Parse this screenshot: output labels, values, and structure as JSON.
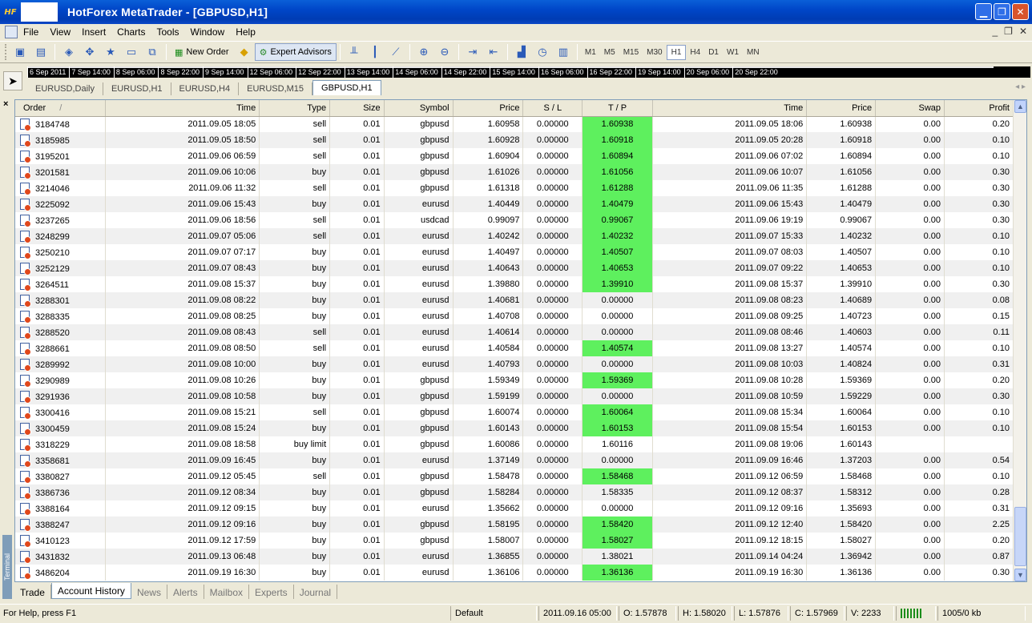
{
  "window": {
    "title": "HotForex MetaTrader - [GBPUSD,H1]",
    "app_logo": "HF"
  },
  "menu": [
    "File",
    "View",
    "Insert",
    "Charts",
    "Tools",
    "Window",
    "Help"
  ],
  "toolbar": {
    "new_order_label": "New Order",
    "expert_advisors_label": "Expert Advisors",
    "timeframes": [
      "M1",
      "M5",
      "M15",
      "M30",
      "H1",
      "H4",
      "D1",
      "W1",
      "MN"
    ],
    "selected_timeframe": "H1"
  },
  "timeline": [
    "6 Sep 2011",
    "7 Sep 14:00",
    "8 Sep 06:00",
    "8 Sep 22:00",
    "9 Sep 14:00",
    "12 Sep 06:00",
    "12 Sep 22:00",
    "13 Sep 14:00",
    "14 Sep 06:00",
    "14 Sep 22:00",
    "15 Sep 14:00",
    "16 Sep 06:00",
    "16 Sep 22:00",
    "19 Sep 14:00",
    "20 Sep 06:00",
    "20 Sep 22:00"
  ],
  "chart_tabs": [
    "EURUSD,Daily",
    "EURUSD,H1",
    "EURUSD,H4",
    "EURUSD,M15",
    "GBPUSD,H1"
  ],
  "active_chart_tab": "GBPUSD,H1",
  "terminal_label": "Terminal",
  "columns": {
    "order": "Order",
    "sort_mark": "/",
    "time": "Time",
    "type": "Type",
    "size": "Size",
    "symbol": "Symbol",
    "price": "Price",
    "sl": "S / L",
    "tp": "T / P",
    "close_time": "Time",
    "close_price": "Price",
    "swap": "Swap",
    "profit": "Profit"
  },
  "highlight_color": "#5ef05e",
  "rows": [
    {
      "order": "3184748",
      "time": "2011.09.05 18:05",
      "type": "sell",
      "size": "0.01",
      "symbol": "gbpusd",
      "price": "1.60958",
      "sl": "0.00000",
      "tp": "1.60938",
      "tp_hit": true,
      "close_time": "2011.09.05 18:06",
      "close_price": "1.60938",
      "swap": "0.00",
      "profit": "0.20"
    },
    {
      "order": "3185985",
      "time": "2011.09.05 18:50",
      "type": "sell",
      "size": "0.01",
      "symbol": "gbpusd",
      "price": "1.60928",
      "sl": "0.00000",
      "tp": "1.60918",
      "tp_hit": true,
      "close_time": "2011.09.05 20:28",
      "close_price": "1.60918",
      "swap": "0.00",
      "profit": "0.10"
    },
    {
      "order": "3195201",
      "time": "2011.09.06 06:59",
      "type": "sell",
      "size": "0.01",
      "symbol": "gbpusd",
      "price": "1.60904",
      "sl": "0.00000",
      "tp": "1.60894",
      "tp_hit": true,
      "close_time": "2011.09.06 07:02",
      "close_price": "1.60894",
      "swap": "0.00",
      "profit": "0.10"
    },
    {
      "order": "3201581",
      "time": "2011.09.06 10:06",
      "type": "buy",
      "size": "0.01",
      "symbol": "gbpusd",
      "price": "1.61026",
      "sl": "0.00000",
      "tp": "1.61056",
      "tp_hit": true,
      "close_time": "2011.09.06 10:07",
      "close_price": "1.61056",
      "swap": "0.00",
      "profit": "0.30"
    },
    {
      "order": "3214046",
      "time": "2011.09.06 11:32",
      "type": "sell",
      "size": "0.01",
      "symbol": "gbpusd",
      "price": "1.61318",
      "sl": "0.00000",
      "tp": "1.61288",
      "tp_hit": true,
      "close_time": "2011.09.06 11:35",
      "close_price": "1.61288",
      "swap": "0.00",
      "profit": "0.30"
    },
    {
      "order": "3225092",
      "time": "2011.09.06 15:43",
      "type": "buy",
      "size": "0.01",
      "symbol": "eurusd",
      "price": "1.40449",
      "sl": "0.00000",
      "tp": "1.40479",
      "tp_hit": true,
      "close_time": "2011.09.06 15:43",
      "close_price": "1.40479",
      "swap": "0.00",
      "profit": "0.30"
    },
    {
      "order": "3237265",
      "time": "2011.09.06 18:56",
      "type": "sell",
      "size": "0.01",
      "symbol": "usdcad",
      "price": "0.99097",
      "sl": "0.00000",
      "tp": "0.99067",
      "tp_hit": true,
      "close_time": "2011.09.06 19:19",
      "close_price": "0.99067",
      "swap": "0.00",
      "profit": "0.30"
    },
    {
      "order": "3248299",
      "time": "2011.09.07 05:06",
      "type": "sell",
      "size": "0.01",
      "symbol": "eurusd",
      "price": "1.40242",
      "sl": "0.00000",
      "tp": "1.40232",
      "tp_hit": true,
      "close_time": "2011.09.07 15:33",
      "close_price": "1.40232",
      "swap": "0.00",
      "profit": "0.10"
    },
    {
      "order": "3250210",
      "time": "2011.09.07 07:17",
      "type": "buy",
      "size": "0.01",
      "symbol": "eurusd",
      "price": "1.40497",
      "sl": "0.00000",
      "tp": "1.40507",
      "tp_hit": true,
      "close_time": "2011.09.07 08:03",
      "close_price": "1.40507",
      "swap": "0.00",
      "profit": "0.10"
    },
    {
      "order": "3252129",
      "time": "2011.09.07 08:43",
      "type": "buy",
      "size": "0.01",
      "symbol": "eurusd",
      "price": "1.40643",
      "sl": "0.00000",
      "tp": "1.40653",
      "tp_hit": true,
      "close_time": "2011.09.07 09:22",
      "close_price": "1.40653",
      "swap": "0.00",
      "profit": "0.10"
    },
    {
      "order": "3264511",
      "time": "2011.09.08 15:37",
      "type": "buy",
      "size": "0.01",
      "symbol": "eurusd",
      "price": "1.39880",
      "sl": "0.00000",
      "tp": "1.39910",
      "tp_hit": true,
      "close_time": "2011.09.08 15:37",
      "close_price": "1.39910",
      "swap": "0.00",
      "profit": "0.30"
    },
    {
      "order": "3288301",
      "time": "2011.09.08 08:22",
      "type": "buy",
      "size": "0.01",
      "symbol": "eurusd",
      "price": "1.40681",
      "sl": "0.00000",
      "tp": "0.00000",
      "tp_hit": false,
      "close_time": "2011.09.08 08:23",
      "close_price": "1.40689",
      "swap": "0.00",
      "profit": "0.08"
    },
    {
      "order": "3288335",
      "time": "2011.09.08 08:25",
      "type": "buy",
      "size": "0.01",
      "symbol": "eurusd",
      "price": "1.40708",
      "sl": "0.00000",
      "tp": "0.00000",
      "tp_hit": false,
      "close_time": "2011.09.08 09:25",
      "close_price": "1.40723",
      "swap": "0.00",
      "profit": "0.15"
    },
    {
      "order": "3288520",
      "time": "2011.09.08 08:43",
      "type": "sell",
      "size": "0.01",
      "symbol": "eurusd",
      "price": "1.40614",
      "sl": "0.00000",
      "tp": "0.00000",
      "tp_hit": false,
      "close_time": "2011.09.08 08:46",
      "close_price": "1.40603",
      "swap": "0.00",
      "profit": "0.11"
    },
    {
      "order": "3288661",
      "time": "2011.09.08 08:50",
      "type": "sell",
      "size": "0.01",
      "symbol": "eurusd",
      "price": "1.40584",
      "sl": "0.00000",
      "tp": "1.40574",
      "tp_hit": true,
      "close_time": "2011.09.08 13:27",
      "close_price": "1.40574",
      "swap": "0.00",
      "profit": "0.10"
    },
    {
      "order": "3289992",
      "time": "2011.09.08 10:00",
      "type": "buy",
      "size": "0.01",
      "symbol": "eurusd",
      "price": "1.40793",
      "sl": "0.00000",
      "tp": "0.00000",
      "tp_hit": false,
      "close_time": "2011.09.08 10:03",
      "close_price": "1.40824",
      "swap": "0.00",
      "profit": "0.31"
    },
    {
      "order": "3290989",
      "time": "2011.09.08 10:26",
      "type": "buy",
      "size": "0.01",
      "symbol": "gbpusd",
      "price": "1.59349",
      "sl": "0.00000",
      "tp": "1.59369",
      "tp_hit": true,
      "close_time": "2011.09.08 10:28",
      "close_price": "1.59369",
      "swap": "0.00",
      "profit": "0.20"
    },
    {
      "order": "3291936",
      "time": "2011.09.08 10:58",
      "type": "buy",
      "size": "0.01",
      "symbol": "gbpusd",
      "price": "1.59199",
      "sl": "0.00000",
      "tp": "0.00000",
      "tp_hit": false,
      "close_time": "2011.09.08 10:59",
      "close_price": "1.59229",
      "swap": "0.00",
      "profit": "0.30"
    },
    {
      "order": "3300416",
      "time": "2011.09.08 15:21",
      "type": "sell",
      "size": "0.01",
      "symbol": "gbpusd",
      "price": "1.60074",
      "sl": "0.00000",
      "tp": "1.60064",
      "tp_hit": true,
      "close_time": "2011.09.08 15:34",
      "close_price": "1.60064",
      "swap": "0.00",
      "profit": "0.10"
    },
    {
      "order": "3300459",
      "time": "2011.09.08 15:24",
      "type": "buy",
      "size": "0.01",
      "symbol": "gbpusd",
      "price": "1.60143",
      "sl": "0.00000",
      "tp": "1.60153",
      "tp_hit": true,
      "close_time": "2011.09.08 15:54",
      "close_price": "1.60153",
      "swap": "0.00",
      "profit": "0.10"
    },
    {
      "order": "3318229",
      "time": "2011.09.08 18:58",
      "type": "buy limit",
      "size": "0.01",
      "symbol": "gbpusd",
      "price": "1.60086",
      "sl": "0.00000",
      "tp": "1.60116",
      "tp_hit": false,
      "close_time": "2011.09.08 19:06",
      "close_price": "1.60143",
      "swap": "",
      "profit": ""
    },
    {
      "order": "3358681",
      "time": "2011.09.09 16:45",
      "type": "buy",
      "size": "0.01",
      "symbol": "eurusd",
      "price": "1.37149",
      "sl": "0.00000",
      "tp": "0.00000",
      "tp_hit": false,
      "close_time": "2011.09.09 16:46",
      "close_price": "1.37203",
      "swap": "0.00",
      "profit": "0.54"
    },
    {
      "order": "3380827",
      "time": "2011.09.12 05:45",
      "type": "sell",
      "size": "0.01",
      "symbol": "gbpusd",
      "price": "1.58478",
      "sl": "0.00000",
      "tp": "1.58468",
      "tp_hit": true,
      "close_time": "2011.09.12 06:59",
      "close_price": "1.58468",
      "swap": "0.00",
      "profit": "0.10"
    },
    {
      "order": "3386736",
      "time": "2011.09.12 08:34",
      "type": "buy",
      "size": "0.01",
      "symbol": "gbpusd",
      "price": "1.58284",
      "sl": "0.00000",
      "tp": "1.58335",
      "tp_hit": false,
      "close_time": "2011.09.12 08:37",
      "close_price": "1.58312",
      "swap": "0.00",
      "profit": "0.28"
    },
    {
      "order": "3388164",
      "time": "2011.09.12 09:15",
      "type": "buy",
      "size": "0.01",
      "symbol": "eurusd",
      "price": "1.35662",
      "sl": "0.00000",
      "tp": "0.00000",
      "tp_hit": false,
      "close_time": "2011.09.12 09:16",
      "close_price": "1.35693",
      "swap": "0.00",
      "profit": "0.31"
    },
    {
      "order": "3388247",
      "time": "2011.09.12 09:16",
      "type": "buy",
      "size": "0.01",
      "symbol": "gbpusd",
      "price": "1.58195",
      "sl": "0.00000",
      "tp": "1.58420",
      "tp_hit": true,
      "close_time": "2011.09.12 12:40",
      "close_price": "1.58420",
      "swap": "0.00",
      "profit": "2.25"
    },
    {
      "order": "3410123",
      "time": "2011.09.12 17:59",
      "type": "buy",
      "size": "0.01",
      "symbol": "gbpusd",
      "price": "1.58007",
      "sl": "0.00000",
      "tp": "1.58027",
      "tp_hit": true,
      "close_time": "2011.09.12 18:15",
      "close_price": "1.58027",
      "swap": "0.00",
      "profit": "0.20"
    },
    {
      "order": "3431832",
      "time": "2011.09.13 06:48",
      "type": "buy",
      "size": "0.01",
      "symbol": "eurusd",
      "price": "1.36855",
      "sl": "0.00000",
      "tp": "1.38021",
      "tp_hit": false,
      "close_time": "2011.09.14 04:24",
      "close_price": "1.36942",
      "swap": "0.00",
      "profit": "0.87"
    },
    {
      "order": "3486204",
      "time": "2011.09.19 16:30",
      "type": "buy",
      "size": "0.01",
      "symbol": "eurusd",
      "price": "1.36106",
      "sl": "0.00000",
      "tp": "1.36136",
      "tp_hit": true,
      "close_time": "2011.09.19 16:30",
      "close_price": "1.36136",
      "swap": "0.00",
      "profit": "0.30"
    }
  ],
  "bottom_tabs": [
    "Trade",
    "Account History",
    "News",
    "Alerts",
    "Mailbox",
    "Experts",
    "Journal"
  ],
  "active_bottom_tab": "Account History",
  "status": {
    "help": "For Help, press F1",
    "profile": "Default",
    "datetime": "2011.09.16 05:00",
    "open": "O: 1.57878",
    "high": "H: 1.58020",
    "low": "L: 1.57876",
    "close": "C: 1.57969",
    "volume": "V: 2233",
    "traffic": "1005/0 kb"
  }
}
